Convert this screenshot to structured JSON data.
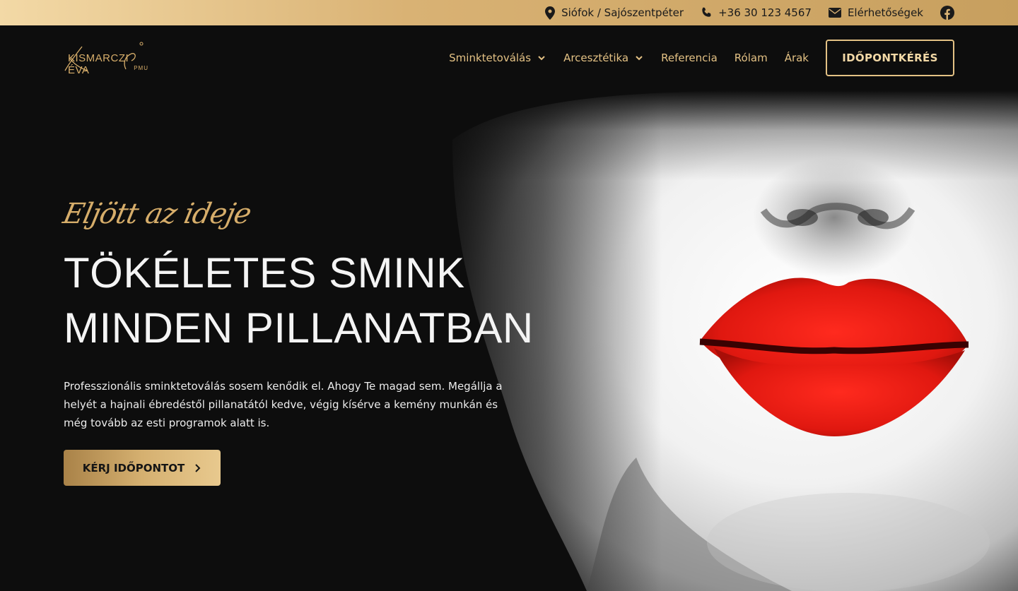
{
  "topbar": {
    "location": "Siófok / Sajószentpéter",
    "phone": "+36 30 123 4567",
    "contact": "Elérhetőségek",
    "location_icon": "map-pin-icon",
    "phone_icon": "phone-icon",
    "contact_icon": "envelope-icon",
    "social_icon": "facebook-icon"
  },
  "brand": {
    "name": "KISMARCZI ÉVA",
    "sub": "PMU"
  },
  "nav": {
    "items": [
      {
        "label": "Sminktetoválás",
        "dropdown": true
      },
      {
        "label": "Arcesztétika",
        "dropdown": true
      },
      {
        "label": "Referencia",
        "dropdown": false
      },
      {
        "label": "Rólam",
        "dropdown": false
      },
      {
        "label": "Árak",
        "dropdown": false
      }
    ],
    "cta": "IDŐPONTKÉRÉS"
  },
  "hero": {
    "script": "Eljött az ideje",
    "headline_1": "TÖKÉLETES SMINK",
    "headline_2": "MINDEN PILLANATBAN",
    "description": "Professzionális sminktetoválás sosem kenődik el. Ahogy Te magad sem. Megállja a helyét a hajnali ébredéstől pillanatától kedve, végig kísérve a kemény munkán és még tovább az esti programok alatt is.",
    "button": "KÉRJ IDŐPONTOT"
  },
  "colors": {
    "gold": "#d6ad6a",
    "background": "#0d0d0d",
    "lips": "#e21a14"
  }
}
